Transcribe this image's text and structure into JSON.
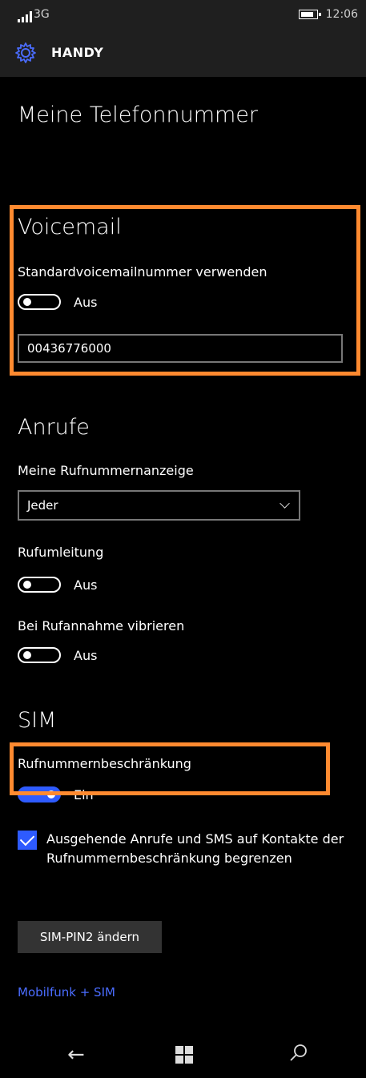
{
  "statusbar": {
    "network": "3G",
    "time": "12:06"
  },
  "header": {
    "title": "HANDY"
  },
  "my_number": {
    "title": "Meine Telefonnummer"
  },
  "voicemail": {
    "title": "Voicemail",
    "default_label": "Standardvoicemailnummer verwenden",
    "default_state": "Aus",
    "number_value": "00436776000"
  },
  "calls": {
    "title": "Anrufe",
    "caller_id_label": "Meine Rufnummernanzeige",
    "caller_id_value": "Jeder",
    "forwarding_label": "Rufumleitung",
    "forwarding_state": "Aus",
    "vibrate_label": "Bei Rufannahme vibrieren",
    "vibrate_state": "Aus"
  },
  "sim": {
    "title": "SIM",
    "fdn_label": "Rufnummernbeschränkung",
    "fdn_state": "Ein",
    "restrict_checkbox": "Ausgehende Anrufe und SMS auf Kontakte der Rufnummernbeschränkung begrenzen",
    "change_pin2_button": "SIM-PIN2 ändern",
    "link": "Mobilfunk + SIM"
  },
  "colors": {
    "accent": "#2e5bff",
    "highlight": "#ff8a30"
  },
  "icons": [
    "signal-icon",
    "battery-icon",
    "gear-icon",
    "back-icon",
    "windows-icon",
    "search-icon"
  ]
}
